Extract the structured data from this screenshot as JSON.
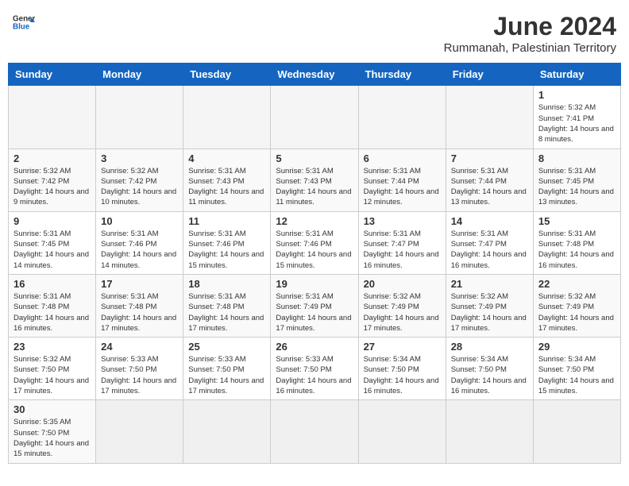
{
  "header": {
    "logo_general": "General",
    "logo_blue": "Blue",
    "title": "June 2024",
    "subtitle": "Rummanah, Palestinian Territory"
  },
  "weekdays": [
    "Sunday",
    "Monday",
    "Tuesday",
    "Wednesday",
    "Thursday",
    "Friday",
    "Saturday"
  ],
  "weeks": [
    [
      {
        "day": "",
        "empty": true
      },
      {
        "day": "",
        "empty": true
      },
      {
        "day": "",
        "empty": true
      },
      {
        "day": "",
        "empty": true
      },
      {
        "day": "",
        "empty": true
      },
      {
        "day": "",
        "empty": true
      },
      {
        "day": "1",
        "sunrise": "5:32 AM",
        "sunset": "7:41 PM",
        "daylight": "14 hours and 8 minutes."
      }
    ],
    [
      {
        "day": "2",
        "sunrise": "5:32 AM",
        "sunset": "7:42 PM",
        "daylight": "14 hours and 9 minutes."
      },
      {
        "day": "3",
        "sunrise": "5:32 AM",
        "sunset": "7:42 PM",
        "daylight": "14 hours and 10 minutes."
      },
      {
        "day": "4",
        "sunrise": "5:31 AM",
        "sunset": "7:43 PM",
        "daylight": "14 hours and 11 minutes."
      },
      {
        "day": "5",
        "sunrise": "5:31 AM",
        "sunset": "7:43 PM",
        "daylight": "14 hours and 11 minutes."
      },
      {
        "day": "6",
        "sunrise": "5:31 AM",
        "sunset": "7:44 PM",
        "daylight": "14 hours and 12 minutes."
      },
      {
        "day": "7",
        "sunrise": "5:31 AM",
        "sunset": "7:44 PM",
        "daylight": "14 hours and 13 minutes."
      },
      {
        "day": "8",
        "sunrise": "5:31 AM",
        "sunset": "7:45 PM",
        "daylight": "14 hours and 13 minutes."
      }
    ],
    [
      {
        "day": "9",
        "sunrise": "5:31 AM",
        "sunset": "7:45 PM",
        "daylight": "14 hours and 14 minutes."
      },
      {
        "day": "10",
        "sunrise": "5:31 AM",
        "sunset": "7:46 PM",
        "daylight": "14 hours and 14 minutes."
      },
      {
        "day": "11",
        "sunrise": "5:31 AM",
        "sunset": "7:46 PM",
        "daylight": "14 hours and 15 minutes."
      },
      {
        "day": "12",
        "sunrise": "5:31 AM",
        "sunset": "7:46 PM",
        "daylight": "14 hours and 15 minutes."
      },
      {
        "day": "13",
        "sunrise": "5:31 AM",
        "sunset": "7:47 PM",
        "daylight": "14 hours and 16 minutes."
      },
      {
        "day": "14",
        "sunrise": "5:31 AM",
        "sunset": "7:47 PM",
        "daylight": "14 hours and 16 minutes."
      },
      {
        "day": "15",
        "sunrise": "5:31 AM",
        "sunset": "7:48 PM",
        "daylight": "14 hours and 16 minutes."
      }
    ],
    [
      {
        "day": "16",
        "sunrise": "5:31 AM",
        "sunset": "7:48 PM",
        "daylight": "14 hours and 16 minutes."
      },
      {
        "day": "17",
        "sunrise": "5:31 AM",
        "sunset": "7:48 PM",
        "daylight": "14 hours and 17 minutes."
      },
      {
        "day": "18",
        "sunrise": "5:31 AM",
        "sunset": "7:48 PM",
        "daylight": "14 hours and 17 minutes."
      },
      {
        "day": "19",
        "sunrise": "5:31 AM",
        "sunset": "7:49 PM",
        "daylight": "14 hours and 17 minutes."
      },
      {
        "day": "20",
        "sunrise": "5:32 AM",
        "sunset": "7:49 PM",
        "daylight": "14 hours and 17 minutes."
      },
      {
        "day": "21",
        "sunrise": "5:32 AM",
        "sunset": "7:49 PM",
        "daylight": "14 hours and 17 minutes."
      },
      {
        "day": "22",
        "sunrise": "5:32 AM",
        "sunset": "7:49 PM",
        "daylight": "14 hours and 17 minutes."
      }
    ],
    [
      {
        "day": "23",
        "sunrise": "5:32 AM",
        "sunset": "7:50 PM",
        "daylight": "14 hours and 17 minutes."
      },
      {
        "day": "24",
        "sunrise": "5:33 AM",
        "sunset": "7:50 PM",
        "daylight": "14 hours and 17 minutes."
      },
      {
        "day": "25",
        "sunrise": "5:33 AM",
        "sunset": "7:50 PM",
        "daylight": "14 hours and 17 minutes."
      },
      {
        "day": "26",
        "sunrise": "5:33 AM",
        "sunset": "7:50 PM",
        "daylight": "14 hours and 16 minutes."
      },
      {
        "day": "27",
        "sunrise": "5:34 AM",
        "sunset": "7:50 PM",
        "daylight": "14 hours and 16 minutes."
      },
      {
        "day": "28",
        "sunrise": "5:34 AM",
        "sunset": "7:50 PM",
        "daylight": "14 hours and 16 minutes."
      },
      {
        "day": "29",
        "sunrise": "5:34 AM",
        "sunset": "7:50 PM",
        "daylight": "14 hours and 15 minutes."
      }
    ],
    [
      {
        "day": "30",
        "sunrise": "5:35 AM",
        "sunset": "7:50 PM",
        "daylight": "14 hours and 15 minutes."
      },
      {
        "day": "",
        "empty": true
      },
      {
        "day": "",
        "empty": true
      },
      {
        "day": "",
        "empty": true
      },
      {
        "day": "",
        "empty": true
      },
      {
        "day": "",
        "empty": true
      },
      {
        "day": "",
        "empty": true
      }
    ]
  ],
  "labels": {
    "sunrise": "Sunrise:",
    "sunset": "Sunset:",
    "daylight": "Daylight:"
  }
}
